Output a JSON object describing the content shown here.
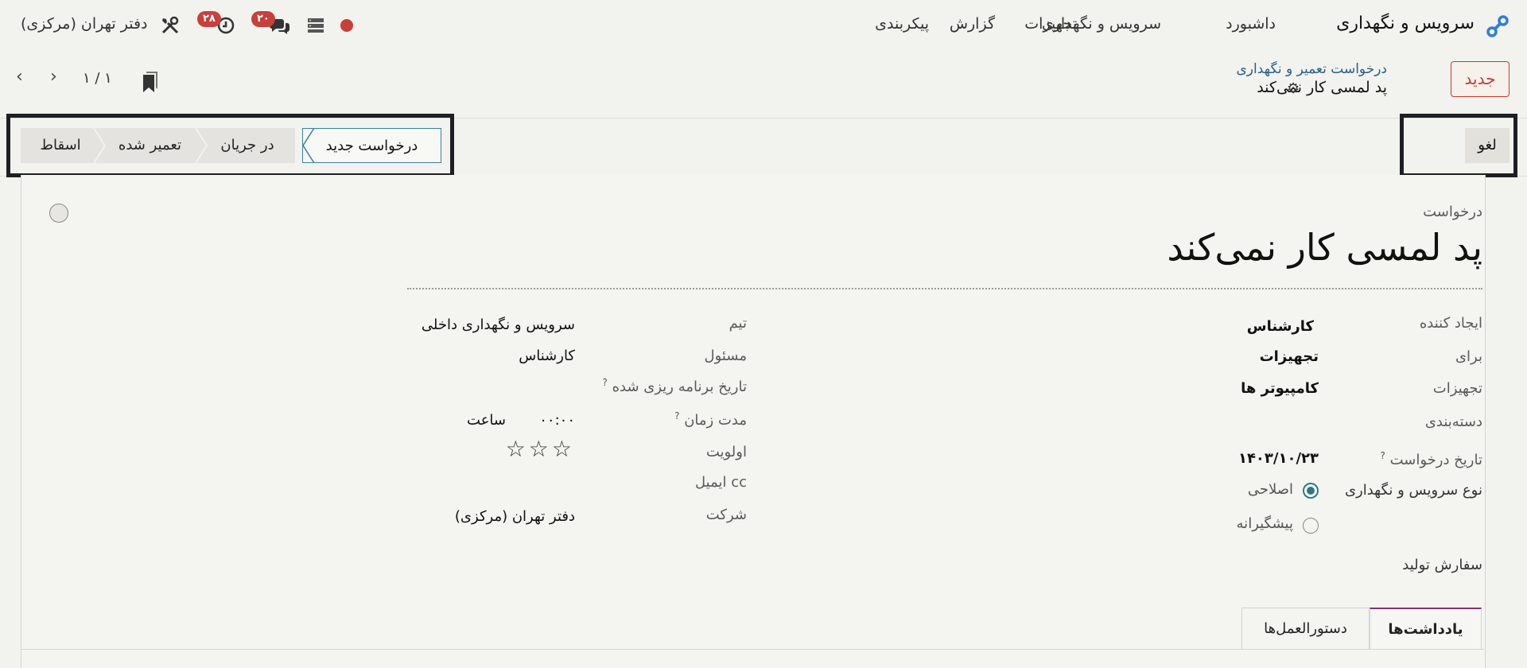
{
  "navbar": {
    "app_title": "سرویس و نگهداری",
    "menu": [
      "داشبورد",
      "سرویس و نگهداری",
      "تجهیزات",
      "گزارش",
      "پیکربندی"
    ],
    "company": "دفتر تهران (مرکزی)",
    "activity_count": "۲۸",
    "messages_count": "۲۰",
    "status_dot_color": "#c83f3b",
    "icons": [
      "app-logo-icon",
      "debug-icon",
      "activity-clock-icon",
      "chat-icon",
      "server-icon",
      "tools-icon"
    ]
  },
  "control_panel": {
    "new_button": "جدید",
    "breadcrumb": "درخواست تعمیر و نگهداری",
    "record_name": "پد لمسی کار نمی‌کند",
    "pager": "۱ / ۱"
  },
  "statusbar": {
    "stages": [
      "درخواست جدید",
      "در جریان",
      "تعمیر شده",
      "اسقاط"
    ],
    "active_stage": "درخواست جدید",
    "cancel_button": "لغو"
  },
  "form": {
    "header_label": "درخواست",
    "title": "پد لمسی کار نمی‌کند",
    "left": {
      "created_by_label": "ایجاد کننده",
      "created_by": "کارشناس",
      "for_label": "برای",
      "for": "تجهیزات",
      "equipment_label": "تجهیزات",
      "equipment": "کامپیوتر ها",
      "category_label": "دسته‌بندی",
      "request_date_label": "تاریخ درخواست",
      "request_date": "۱۴۰۳/۱۰/۲۳",
      "maintenance_type_label": "نوع سرویس و نگهداری",
      "type_options": [
        "اصلاحی",
        "پیشگیرانه"
      ],
      "type_selected": "اصلاحی",
      "production_order_label": "سفارش تولید"
    },
    "right": {
      "team_label": "تیم",
      "team": "سرویس و نگهداری داخلی",
      "responsible_label": "مسئول",
      "responsible": "کارشناس",
      "scheduled_date_label": "تاریخ برنامه ریزی شده",
      "duration_label": "مدت زمان",
      "duration_value": "۰۰:۰۰",
      "duration_unit": "ساعت",
      "priority_label": "اولویت",
      "priority_stars": "☆☆☆",
      "priority_level": 0,
      "email_cc_label": "ایمیل cc",
      "company_label": "شرکت",
      "company": "دفتر تهران (مرکزی)"
    },
    "help_mark": "?",
    "tabs": [
      "یادداشت‌ها",
      "دستورالعمل‌ها"
    ],
    "active_tab": "یادداشت‌ها"
  }
}
